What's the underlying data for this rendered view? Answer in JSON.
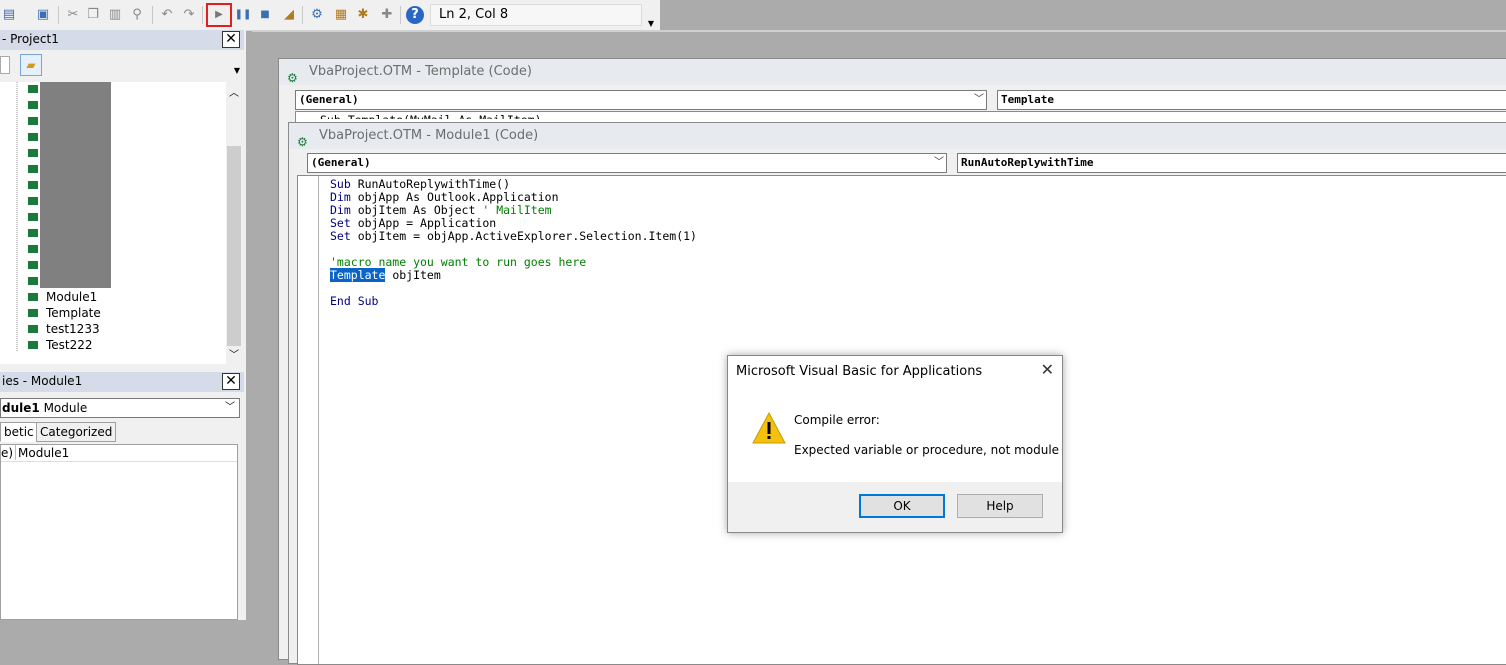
{
  "toolbar": {
    "position_text": "Ln 2, Col 8",
    "icons": [
      "view-icon",
      "save-icon",
      "cut-icon",
      "copy-icon",
      "paste-icon",
      "find-icon",
      "undo-icon",
      "redo-icon",
      "run-icon",
      "break-icon",
      "reset-icon",
      "design-mode-icon",
      "project-explorer-icon",
      "properties-icon",
      "object-browser-icon",
      "toolbox-icon",
      "help-icon"
    ]
  },
  "project_pane": {
    "title": "- Project1",
    "tree_items": [
      "Module1",
      "Template",
      "test1233",
      "Test222"
    ]
  },
  "properties_pane": {
    "title": "ies - Module1",
    "object_name": "dule1",
    "object_type": "Module",
    "tabs": [
      "betic",
      "Categorized"
    ],
    "row_label": "e)",
    "row_value": "Module1"
  },
  "code_window_template": {
    "title": "VbaProject.OTM - Template (Code)",
    "object_combo": "(General)",
    "proc_combo": "Template",
    "partial_line": "Sub Template(MyMail As MailItem)"
  },
  "code_window_module": {
    "title": "VbaProject.OTM - Module1 (Code)",
    "object_combo": "(General)",
    "proc_combo": "RunAutoReplywithTime",
    "code": {
      "l1_kw": "Sub",
      "l1_rest": " RunAutoReplywithTime()",
      "l2_kw": "Dim",
      "l2_rest": " objApp As Outlook.Application",
      "l3_kw": "Dim",
      "l3_rest": " objItem As Object ",
      "l3_cm": "' MailItem",
      "l4_kw": "Set",
      "l4_rest": " objApp = Application",
      "l5_kw": "Set",
      "l5_rest": " objItem = objApp.ActiveExplorer.Selection.Item(1)",
      "l7_cm": "'macro name you want to run goes here",
      "l8_sel": "Template",
      "l8_rest": " objItem",
      "l10": "End Sub"
    }
  },
  "dialog": {
    "title": "Microsoft Visual Basic for Applications",
    "close_glyph": "✕",
    "message_heading": "Compile error:",
    "message_body": "Expected variable or procedure, not module",
    "ok_label": "OK",
    "help_label": "Help"
  },
  "colors": {
    "keyword": "#00007f",
    "comment": "#007f00",
    "selection": "#0a64c8",
    "highlight_box": "#e02020"
  }
}
